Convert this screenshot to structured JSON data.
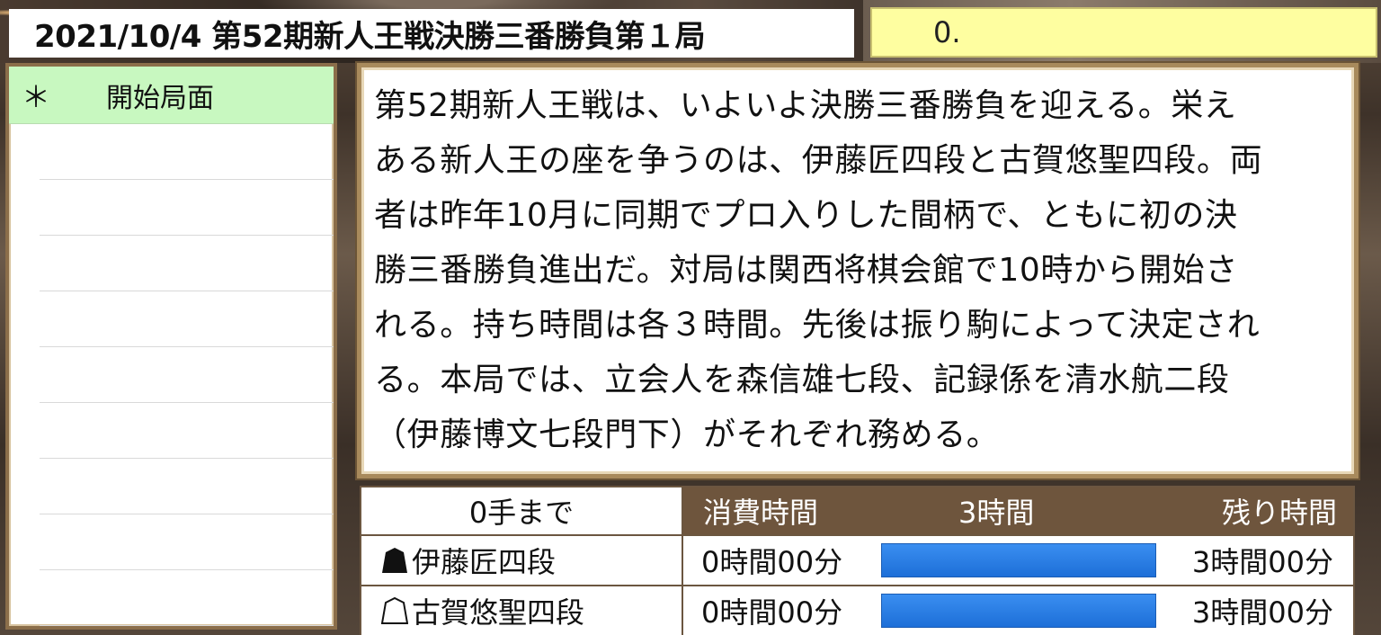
{
  "header": {
    "title": "2021/10/4 第52期新人王戦決勝三番勝負第１局",
    "current_move": "0."
  },
  "move_list": {
    "items": [
      {
        "marker": "＊",
        "label": "開始局面"
      }
    ],
    "empty_rows": 9
  },
  "comment": {
    "lines": [
      "第52期新人王戦は、いよいよ決勝三番勝負を迎える。栄え",
      "ある新人王の座を争うのは、伊藤匠四段と古賀悠聖四段。両",
      "者は昨年10月に同期でプロ入りした間柄で、ともに初の決",
      "勝三番勝負進出だ。対局は関西将棋会館で10時から開始さ",
      "れる。持ち時間は各３時間。先後は振り駒によって決定され",
      "る。本局では、立会人を森信雄七段、記録係を清水航二段",
      "（伊藤博文七段門下）がそれぞれ務める。"
    ]
  },
  "time_table": {
    "moves_label": "0手まで",
    "used_header": "消費時間",
    "total_header": "3時間",
    "remain_header": "残り時間",
    "players": [
      {
        "side": "sente",
        "icon": "black-shogi-piece-icon",
        "name": "伊藤匠四段",
        "used": "0時間00分",
        "remain": "3時間00分",
        "remain_fraction": 1.0
      },
      {
        "side": "gote",
        "icon": "white-shogi-piece-icon",
        "name": "古賀悠聖四段",
        "used": "0時間00分",
        "remain": "3時間00分",
        "remain_fraction": 1.0
      }
    ]
  },
  "colors": {
    "move_box_bg": "#fefea0",
    "selected_row_bg": "#c8f8c0",
    "table_header_bg": "#6e553d",
    "time_bar": "#1d6fd8",
    "panel_border": "#a88a5c"
  }
}
